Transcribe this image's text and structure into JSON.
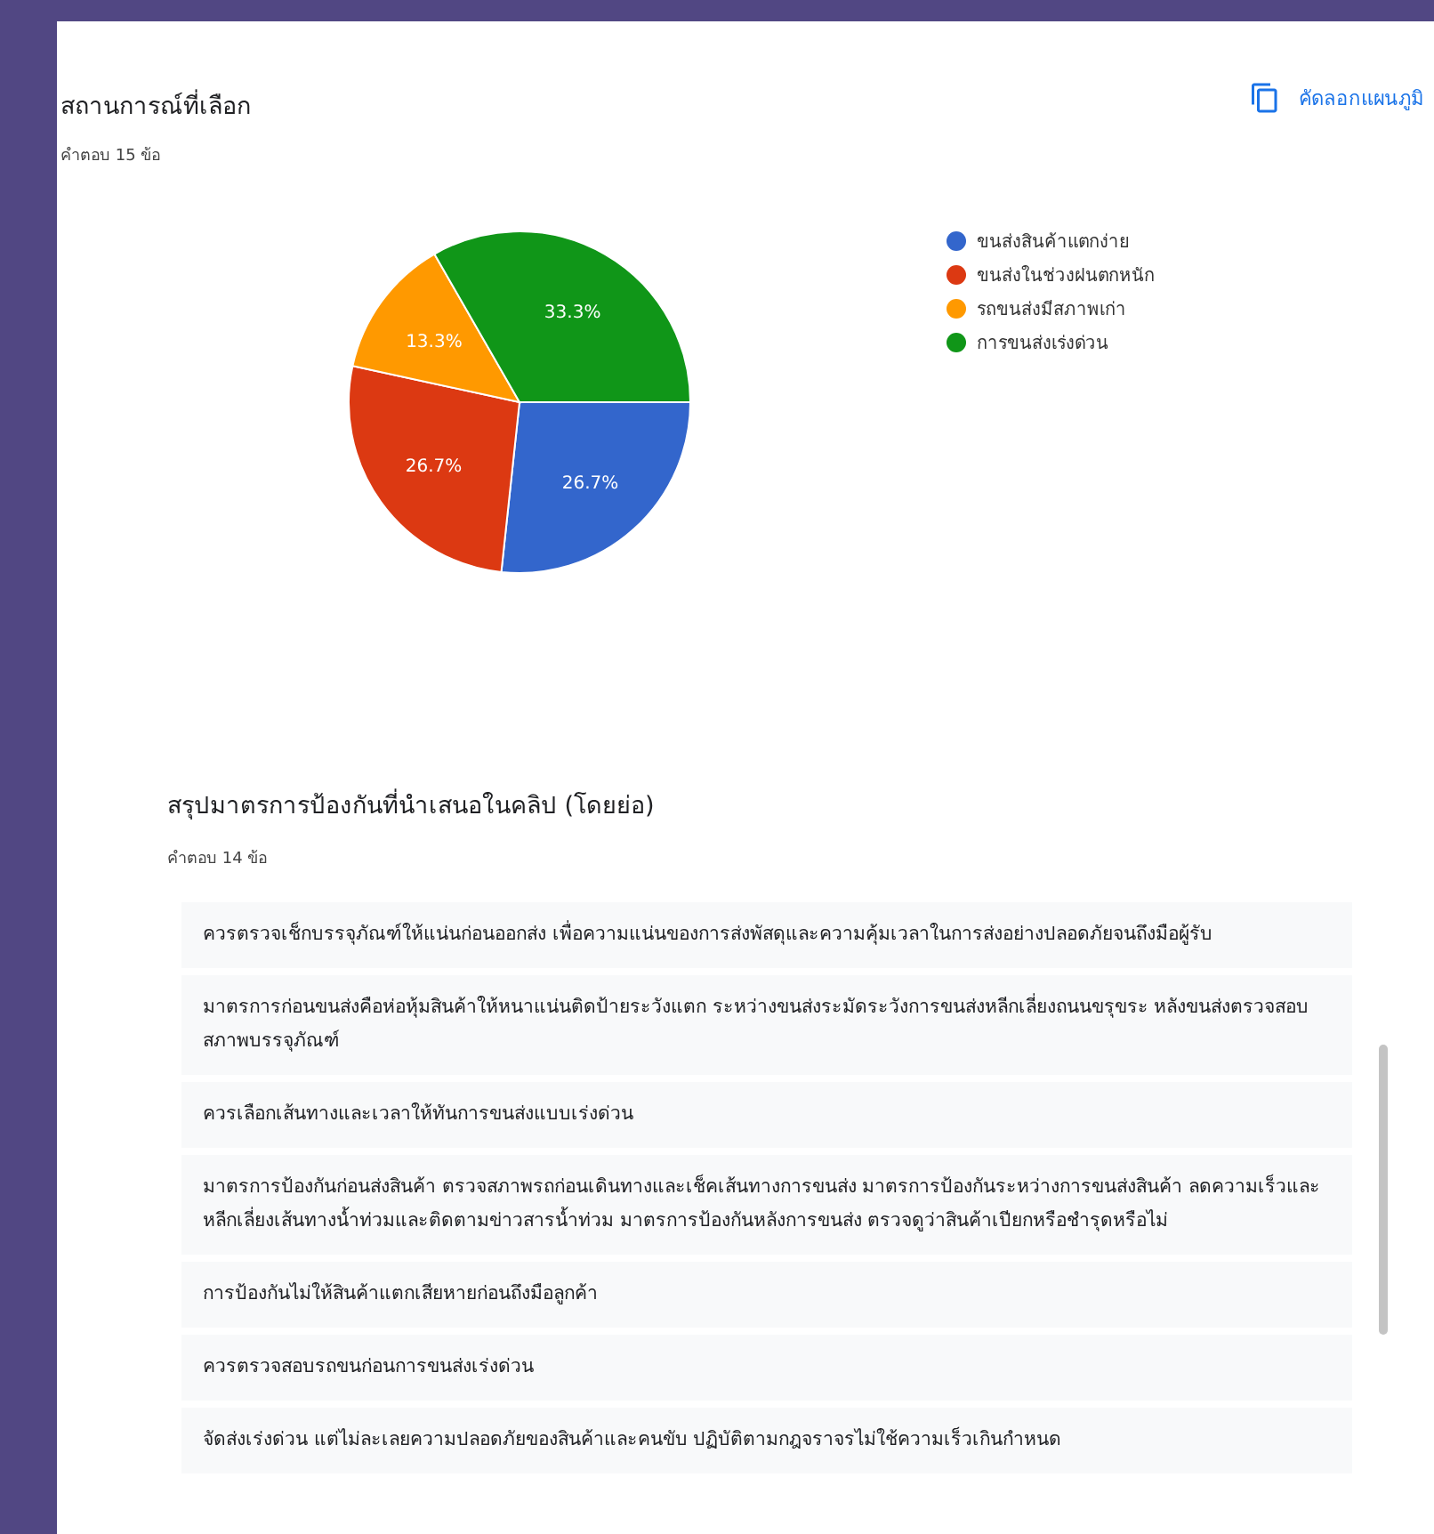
{
  "chart_question": {
    "title": "สถานการณ์ที่เลือก",
    "count": "คำตอบ 15 ข้อ",
    "copy_button": "คัดลอกแผนภูมิ",
    "chart_data": {
      "type": "pie",
      "categories": [
        "ขนส่งสินค้าแตกง่าย",
        "ขนส่งในช่วงฝนตกหนัก",
        "รถขนส่งมีสภาพเก่า",
        "การขนส่งเร่งด่วน"
      ],
      "values": [
        26.7,
        26.7,
        13.3,
        33.3
      ],
      "colors": [
        "#3366cc",
        "#dc3912",
        "#ff9900",
        "#109618"
      ],
      "legend": "right",
      "value_labels": [
        "26.7%",
        "26.7%",
        "13.3%",
        "33.3%"
      ]
    }
  },
  "text_question": {
    "title": "สรุปมาตรการป้องกันที่นำเสนอในคลิป (โดยย่อ)",
    "count": "คำตอบ 14 ข้อ",
    "responses": [
      "ควรตรวจเช็กบรรจุภัณฑ์ให้แน่นก่อนออกส่ง เพื่อความแน่นของการส่งพัสดุและความคุ้มเวลาในการส่งอย่างปลอดภัยจนถึงมือผู้รับ",
      "มาตรการก่อนขนส่งคือห่อหุ้มสินค้าให้หนาแน่นติดป้ายระวังแตก ระหว่างขนส่งระมัดระวังการขนส่งหลีกเลี่ยงถนนขรุขระ หลังขนส่งตรวจสอบสภาพบรรจุภัณฑ์",
      "ควรเลือกเส้นทางและเวลาให้ทันการขนส่งแบบเร่งด่วน",
      "มาตรการป้องกันก่อนส่งสินค้า ตรวจสภาพรถก่อนเดินทางและเช็คเส้นทางการขนส่ง มาตรการป้องกันระหว่างการขนส่งสินค้า ลดความเร็วและหลีกเลี่ยงเส้นทางน้ำท่วมและติดตามข่าวสารน้ำท่วม มาตรการป้องกันหลังการขนส่ง ตรวจดูว่าสินค้าเปียกหรือชำรุดหรือไม่",
      "การป้องกันไม่ให้สินค้าแตกเสียหายก่อนถึงมือลูกค้า",
      "ควรตรวจสอบรถขนก่อนการขนส่งเร่งด่วน",
      "จัดส่งเร่งด่วน แต่ไม่ละเลยความปลอดภัยของสินค้าและคนขับ ปฏิบัติตามกฎจราจรไม่ใช้ความเร็วเกินกำหนด"
    ]
  }
}
